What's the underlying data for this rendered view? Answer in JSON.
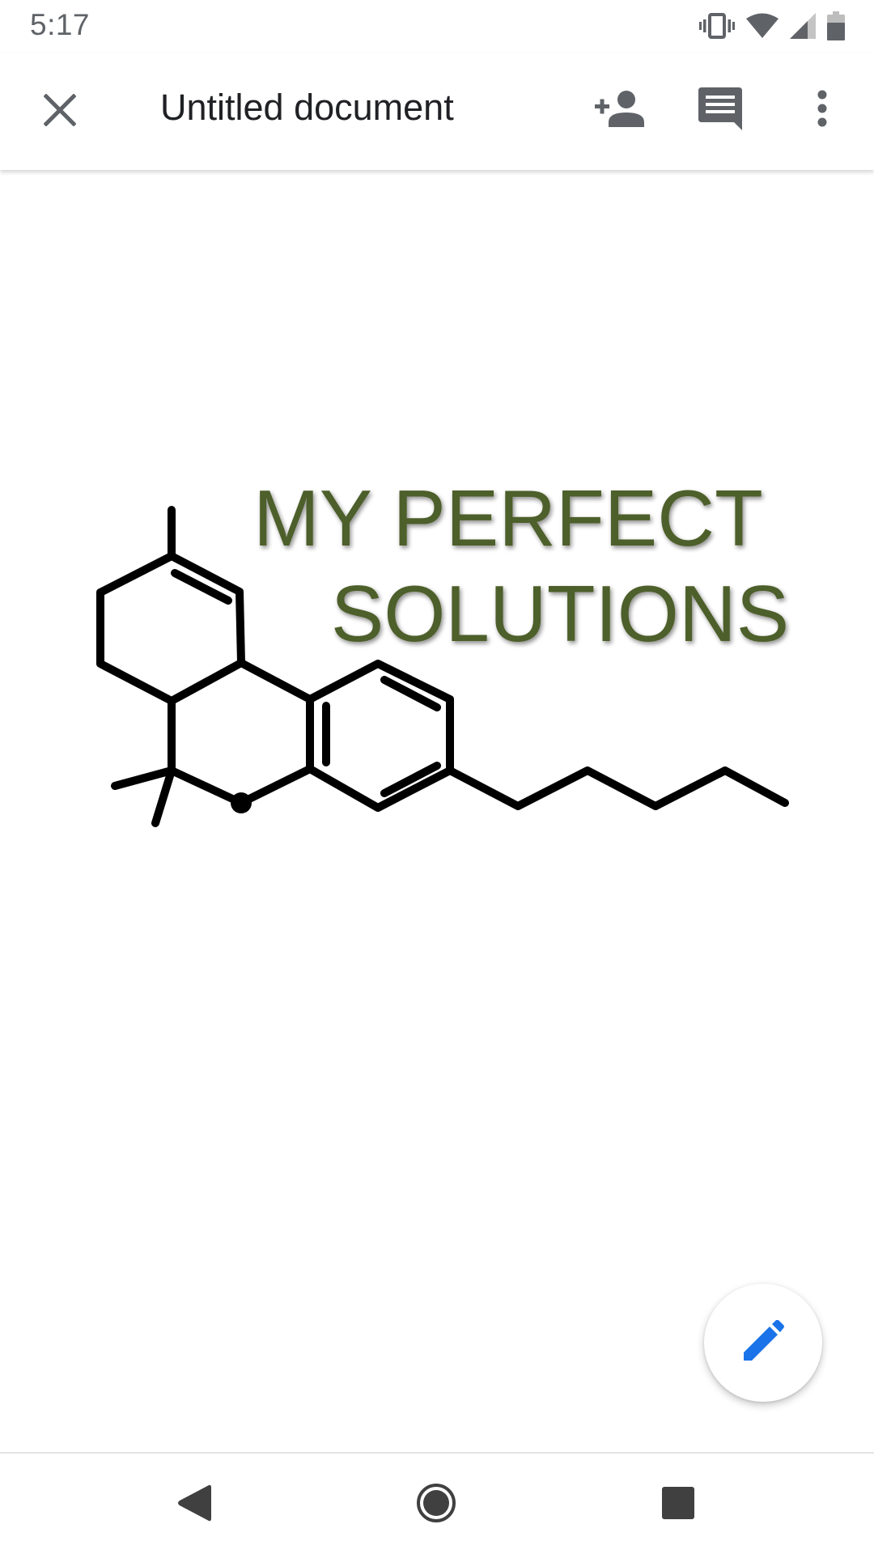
{
  "status_bar": {
    "time": "5:17",
    "icons": [
      "vibrate-icon",
      "wifi-icon",
      "cell-signal-icon",
      "battery-icon"
    ]
  },
  "app_bar": {
    "close_icon": "close-icon",
    "title": "Untitled document",
    "actions": [
      "add-person-icon",
      "comment-icon",
      "more-vert-icon"
    ]
  },
  "document": {
    "logo_line_1": "MY PERFECT",
    "logo_line_2": "SOLUTIONS",
    "logo_text_color": "#4e5f2a",
    "molecule_color": "#000000"
  },
  "fab": {
    "icon": "edit-pencil-icon",
    "color": "#1a73e8"
  },
  "nav_bar": {
    "buttons": [
      "back-icon",
      "home-icon",
      "recents-icon"
    ]
  },
  "colors": {
    "icon_gray": "#5f6368",
    "title_text": "#202124",
    "accent_blue": "#1a73e8"
  }
}
